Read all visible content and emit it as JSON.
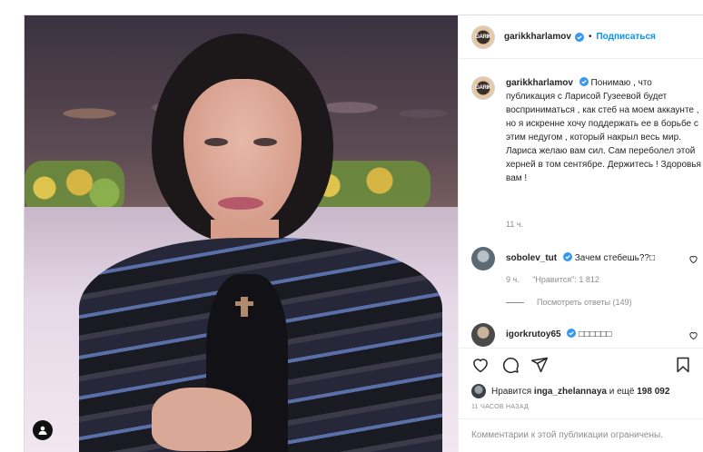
{
  "post": {
    "author": "garikkharlamov",
    "avatar_label": "GARIK",
    "follow_label": "Подписаться",
    "separator": "•",
    "caption": "Понимаю , что публикация с Ларисой Гузеевой будет восприниматься , как стеб на моем аккаунте , но я искренне хочу поддержать ее в борьбе с этим недугом , который накрыл весь мир. Лариса желаю вам сил. Сам переболел этой херней в том сентябре. Держитесь ! Здоровья вам !",
    "caption_time": "11 ч.",
    "likes_text_prefix": "Нравится",
    "likes_user": "inga_zhelannaya",
    "likes_text_mid": "и ещё",
    "likes_count": "198 092",
    "posted_ago": "11 ЧАСОВ НАЗАД",
    "comments_limited": "Комментарии к этой публикации ограничены."
  },
  "comments": [
    {
      "user": "sobolev_tut",
      "text": "Зачем стебешь??",
      "emoji": "□",
      "time": "9 ч.",
      "likes": "\"Нравится\": 1 812",
      "replies": "Посмотреть ответы (149)"
    },
    {
      "user": "igorkrutoy65",
      "text": "□□□□□□"
    }
  ],
  "icons": {
    "verified": "verified-badge-icon",
    "tagged_user": "tagged-user-icon",
    "like": "heart-icon",
    "comment": "comment-bubble-icon",
    "share": "paper-plane-icon",
    "save": "bookmark-icon"
  },
  "colors": {
    "accent": "#0095f6",
    "text": "#262626",
    "secondary": "#8e8e8e",
    "border": "#dbdbdb"
  }
}
